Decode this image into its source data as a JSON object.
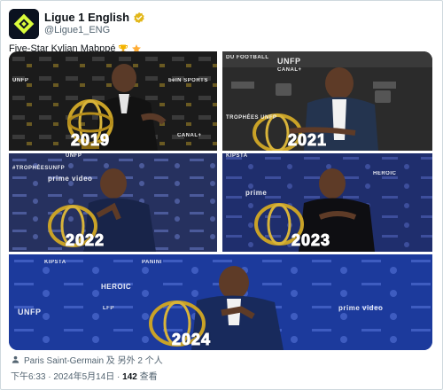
{
  "account": {
    "display_name": "Ligue 1 English",
    "handle": "@Ligue1_ENG",
    "verified_icon": "gold-verified-badge-icon",
    "avatar_icon": "ligue1-logo-icon"
  },
  "tweet": {
    "text": "Five-Star Kylian Mabppé",
    "emojis": [
      "trophy-emoji-icon",
      "star-emoji-icon"
    ]
  },
  "photos": [
    {
      "year": "2019",
      "backdrop_words": [
        "UNFP",
        "CANAL+",
        "beIN SPORTS"
      ]
    },
    {
      "year": "2021",
      "backdrop_words": [
        "DU FOOTBALL",
        "UNFP",
        "CANAL+",
        "TROPHÉES UNFP"
      ]
    },
    {
      "year": "2022",
      "backdrop_words": [
        "UNFP",
        "prime video",
        "#TROPHÉESUNFP"
      ]
    },
    {
      "year": "2023",
      "backdrop_words": [
        "KIPSTA",
        "prime",
        "HEROIC"
      ]
    },
    {
      "year": "2024",
      "backdrop_words": [
        "KIPSTA",
        "PANINI",
        "HEROIC",
        "UNFP",
        "prime video",
        "LFP"
      ]
    }
  ],
  "tagged": {
    "icon": "person-tag-icon",
    "text": "Paris Saint-Germain 及 另外 2 个人"
  },
  "meta": {
    "time_date": "下午6:33 · 2024年5月14日 · ",
    "views_count": "142",
    "views_label": " 查看"
  },
  "colors": {
    "verified_gold": "#e2b719",
    "handle_gray": "#536471",
    "trophy_gold": "#c9a227"
  }
}
